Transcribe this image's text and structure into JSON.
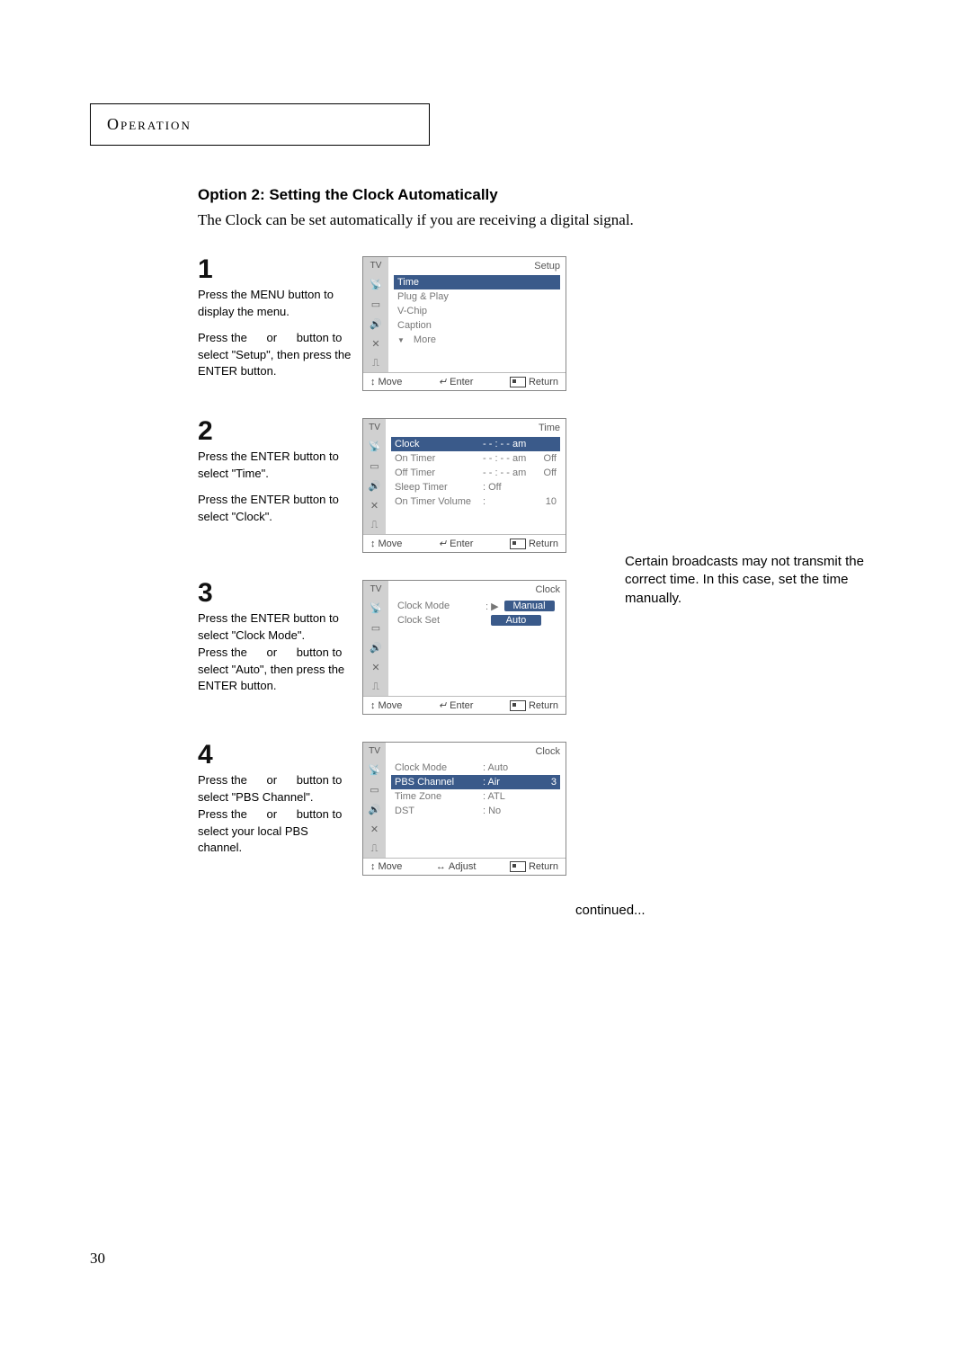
{
  "section": "Operation",
  "title": "Option 2: Setting the Clock Automatically",
  "intro": "The Clock can be set automatically if you are receiving a digital signal.",
  "sidenote": "Certain broadcasts may not transmit the correct time. In this case, set the time manually.",
  "continued": "continued...",
  "page_number": "30",
  "footer": {
    "move": "Move",
    "enter": "Enter",
    "adjust": "Adjust",
    "return": "Return"
  },
  "steps": {
    "s1": {
      "num": "1",
      "lines": {
        "a": "Press the MENU button to display the menu.",
        "b_pre": "Press the ",
        "b_or": "or",
        "b_post": " button to select \"Setup\", then press the ENTER button."
      },
      "osd": {
        "title": "Setup",
        "hl": "Time",
        "items": {
          "i1": "Plug & Play",
          "i2": "V-Chip",
          "i3": "Caption",
          "more": "More"
        }
      }
    },
    "s2": {
      "num": "2",
      "lines": {
        "a": "Press the ENTER button to select \"Time\".",
        "b": "Press the ENTER button to select \"Clock\"."
      },
      "osd": {
        "title": "Time",
        "rows": {
          "r1": {
            "c1": "Clock",
            "c2": "- - : - - am",
            "c3": ""
          },
          "r2": {
            "c1": "On Timer",
            "c2": "- - : - - am",
            "c3": "Off"
          },
          "r3": {
            "c1": "Off Timer",
            "c2": "- - : - - am",
            "c3": "Off"
          },
          "r4": {
            "c1": "Sleep Timer",
            "c2": ": Off",
            "c3": ""
          },
          "r5": {
            "c1": "On Timer Volume",
            "c2": ":",
            "c3": "10"
          }
        }
      }
    },
    "s3": {
      "num": "3",
      "lines": {
        "a": "Press the ENTER button to select \"Clock Mode\".",
        "b_pre": "Press the ",
        "b_or": "or",
        "b_post": " button to select \"Auto\", then press the ENTER button."
      },
      "osd": {
        "title": "Clock",
        "rows": {
          "r1": {
            "c1": "Clock Mode",
            "sep": ": ▶",
            "manual": "Manual"
          },
          "r2": {
            "c1": "Clock Set",
            "val": "Auto"
          }
        }
      }
    },
    "s4": {
      "num": "4",
      "lines": {
        "a_pre": "Press the ",
        "a_or": "or",
        "a_post": " button to select \"PBS Channel\".",
        "b_pre": "Press the ",
        "b_or": "or",
        "b_post": " button to select your local PBS channel."
      },
      "osd": {
        "title": "Clock",
        "rows": {
          "r1": {
            "c1": "Clock Mode",
            "c2": ": Auto"
          },
          "r2": {
            "c1": "PBS Channel",
            "c2": ": Air",
            "c3": "3"
          },
          "r3": {
            "c1": "Time Zone",
            "c2": ": ATL"
          },
          "r4": {
            "c1": "DST",
            "c2": ": No"
          }
        }
      }
    }
  }
}
